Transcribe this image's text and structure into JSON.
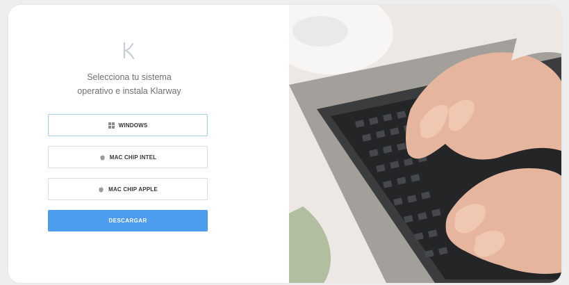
{
  "heading": {
    "line1": "Selecciona tu sistema",
    "line2": "operativo e instala Klarway"
  },
  "options": [
    {
      "label": "WINDOWS",
      "icon": "windows-icon",
      "selected": true
    },
    {
      "label": "MAC CHIP INTEL",
      "icon": "apple-icon",
      "selected": false
    },
    {
      "label": "MAC CHIP APPLE",
      "icon": "apple-icon",
      "selected": false
    }
  ],
  "download_label": "DESCARGAR",
  "colors": {
    "accent": "#4d9cf0",
    "selected_border": "#a9c8ec",
    "heading_text": "#707070"
  },
  "hero_image": "photo of hands typing on a laptop keyboard"
}
